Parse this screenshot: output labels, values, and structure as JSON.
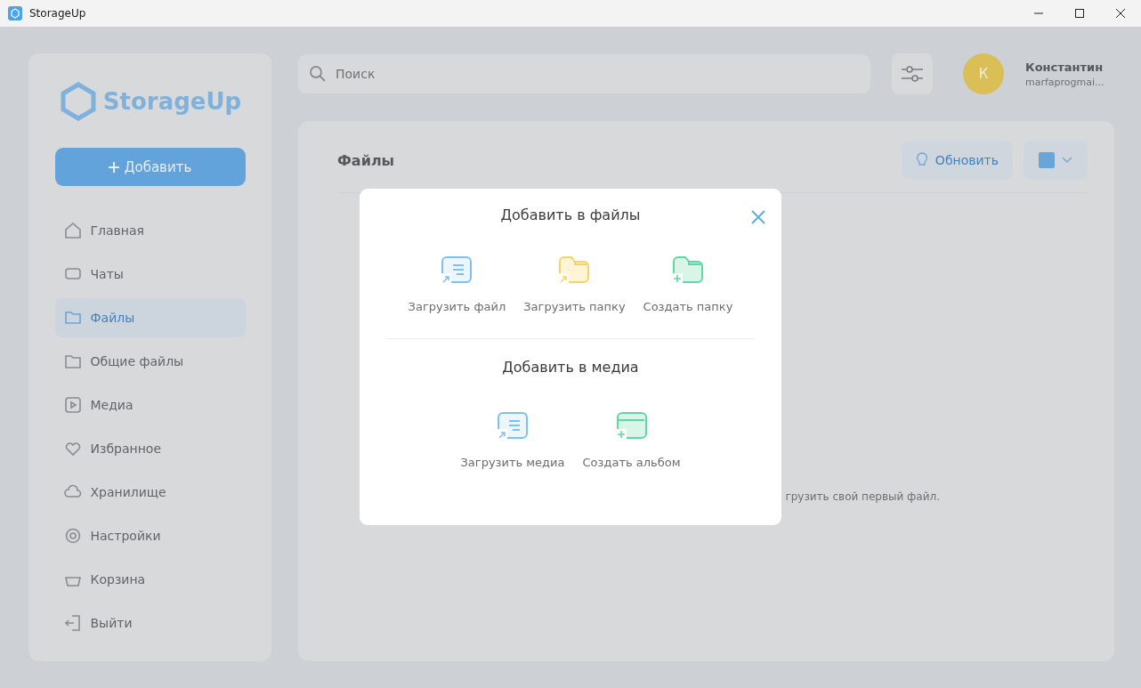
{
  "window": {
    "title": "StorageUp"
  },
  "sidebar": {
    "logo": "StorageUp",
    "add_button": "Добавить",
    "items": [
      {
        "label": "Главная",
        "selected": false
      },
      {
        "label": "Чаты",
        "selected": false
      },
      {
        "label": "Файлы",
        "selected": true
      },
      {
        "label": "Общие файлы",
        "selected": false
      },
      {
        "label": "Медиа",
        "selected": false
      },
      {
        "label": "Избранное",
        "selected": false
      },
      {
        "label": "Хранилище",
        "selected": false
      },
      {
        "label": "Настройки",
        "selected": false
      },
      {
        "label": "Корзина",
        "selected": false
      },
      {
        "label": "Выйти",
        "selected": false
      }
    ]
  },
  "search": {
    "placeholder": "Поиск"
  },
  "user": {
    "initial": "К",
    "name": "Константин",
    "email": "marfaprogmai..."
  },
  "content": {
    "title": "Файлы",
    "refresh_button": "Обновить",
    "empty_hint_fragment": "грузить свой первый файл."
  },
  "dialog": {
    "sections": [
      {
        "title": "Добавить в файлы",
        "actions": [
          {
            "label": "Загрузить файл",
            "kind": "upload-file"
          },
          {
            "label": "Загрузить папку",
            "kind": "upload-folder"
          },
          {
            "label": "Создать папку",
            "kind": "create-folder"
          }
        ]
      },
      {
        "title": "Добавить в медиа",
        "actions": [
          {
            "label": "Загрузить медиа",
            "kind": "upload-file"
          },
          {
            "label": "Создать альбом",
            "kind": "create-album"
          }
        ]
      }
    ]
  }
}
